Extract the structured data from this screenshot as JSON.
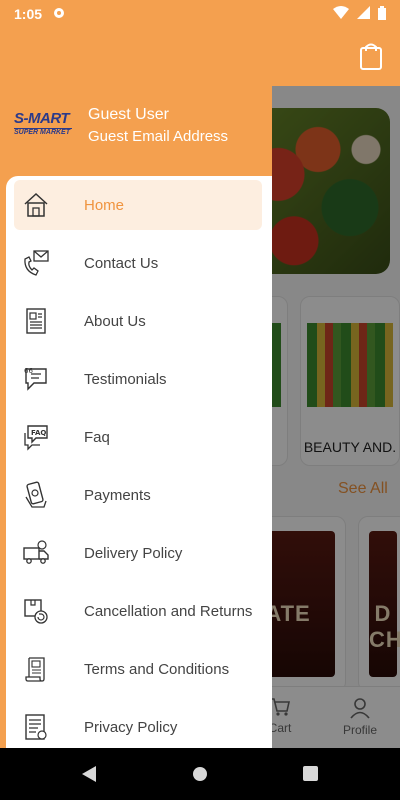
{
  "status": {
    "time": "1:05"
  },
  "drawer": {
    "logo": {
      "line1": "S-MART",
      "line2": "SUPER MARKET"
    },
    "user_name": "Guest User",
    "user_email": "Guest Email Address",
    "items": [
      {
        "label": "Home",
        "icon": "house-icon",
        "active": true
      },
      {
        "label": "Contact Us",
        "icon": "phone-mail-icon"
      },
      {
        "label": "About Us",
        "icon": "document-icon"
      },
      {
        "label": "Testimonials",
        "icon": "quote-bubble-icon"
      },
      {
        "label": "Faq",
        "icon": "faq-bubble-icon"
      },
      {
        "label": "Payments",
        "icon": "cash-icon"
      },
      {
        "label": "Delivery Policy",
        "icon": "delivery-truck-icon"
      },
      {
        "label": "Cancellation and Returns",
        "icon": "return-box-icon"
      },
      {
        "label": "Terms and Conditions",
        "icon": "scroll-icon"
      },
      {
        "label": "Privacy Policy",
        "icon": "policy-doc-icon"
      }
    ]
  },
  "background": {
    "category_label": "BEAUTY AND.",
    "see_all": "See All",
    "product_text_1": "ATE",
    "product_text_2": "D CH",
    "nav": {
      "cart": "Cart",
      "profile": "Profile"
    }
  },
  "colors": {
    "accent": "#f4a04f",
    "active_text": "#f0943f",
    "active_bg": "#fdeee0"
  }
}
